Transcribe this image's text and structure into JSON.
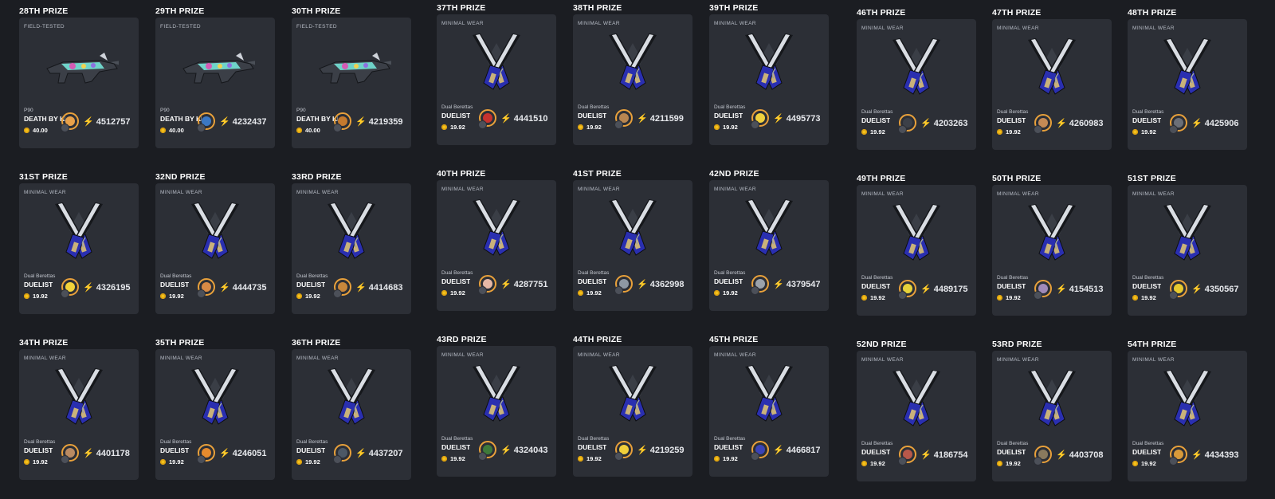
{
  "prizes": [
    {
      "title": "28TH PRIZE",
      "wear": "FIELD-TESTED",
      "weapon": "P90",
      "skin": "DEATH BY KI",
      "price": "40.00",
      "ticket": "4512757",
      "avatar_color": "#e8a14a",
      "kind": "p90"
    },
    {
      "title": "29TH PRIZE",
      "wear": "FIELD-TESTED",
      "weapon": "P90",
      "skin": "DEATH BY KI",
      "price": "40.00",
      "ticket": "4232437",
      "avatar_color": "#3b78c4",
      "kind": "p90"
    },
    {
      "title": "30TH PRIZE",
      "wear": "FIELD-TESTED",
      "weapon": "P90",
      "skin": "DEATH BY KI",
      "price": "40.00",
      "ticket": "4219359",
      "avatar_color": "#c57a2e",
      "kind": "p90"
    },
    {
      "title": "31ST PRIZE",
      "wear": "MINIMAL WEAR",
      "weapon": "Dual Berettas",
      "skin": "DUELIST",
      "price": "19.92",
      "ticket": "4326195",
      "avatar_color": "#f2d23a",
      "kind": "db"
    },
    {
      "title": "32ND PRIZE",
      "wear": "MINIMAL WEAR",
      "weapon": "Dual Berettas",
      "skin": "DUELIST",
      "price": "19.92",
      "ticket": "4444735",
      "avatar_color": "#d88a45",
      "kind": "db"
    },
    {
      "title": "33RD PRIZE",
      "wear": "MINIMAL WEAR",
      "weapon": "Dual Berettas",
      "skin": "DUELIST",
      "price": "19.92",
      "ticket": "4414683",
      "avatar_color": "#c8873b",
      "kind": "db"
    },
    {
      "title": "34TH PRIZE",
      "wear": "MINIMAL WEAR",
      "weapon": "Dual Berettas",
      "skin": "DUELIST",
      "price": "19.92",
      "ticket": "4401178",
      "avatar_color": "#b98a62",
      "kind": "db"
    },
    {
      "title": "35TH PRIZE",
      "wear": "MINIMAL WEAR",
      "weapon": "Dual Berettas",
      "skin": "DUELIST",
      "price": "19.92",
      "ticket": "4246051",
      "avatar_color": "#e58a2e",
      "kind": "db"
    },
    {
      "title": "36TH PRIZE",
      "wear": "MINIMAL WEAR",
      "weapon": "Dual Berettas",
      "skin": "DUELIST",
      "price": "19.92",
      "ticket": "4437207",
      "avatar_color": "#4c5866",
      "kind": "db"
    },
    {
      "title": "37TH PRIZE",
      "wear": "MINIMAL WEAR",
      "weapon": "Dual Berettas",
      "skin": "DUELIST",
      "price": "19.92",
      "ticket": "4441510",
      "avatar_color": "#c7332e",
      "kind": "db"
    },
    {
      "title": "38TH PRIZE",
      "wear": "MINIMAL WEAR",
      "weapon": "Dual Berettas",
      "skin": "DUELIST",
      "price": "19.92",
      "ticket": "4211599",
      "avatar_color": "#b88651",
      "kind": "db"
    },
    {
      "title": "39TH PRIZE",
      "wear": "MINIMAL WEAR",
      "weapon": "Dual Berettas",
      "skin": "DUELIST",
      "price": "19.92",
      "ticket": "4495773",
      "avatar_color": "#f0d03d",
      "kind": "db"
    },
    {
      "title": "40TH PRIZE",
      "wear": "MINIMAL WEAR",
      "weapon": "Dual Berettas",
      "skin": "DUELIST",
      "price": "19.92",
      "ticket": "4287751",
      "avatar_color": "#e6b8a6",
      "kind": "db"
    },
    {
      "title": "41ST PRIZE",
      "wear": "MINIMAL WEAR",
      "weapon": "Dual Berettas",
      "skin": "DUELIST",
      "price": "19.92",
      "ticket": "4362998",
      "avatar_color": "#8e98a3",
      "kind": "db"
    },
    {
      "title": "42ND PRIZE",
      "wear": "MINIMAL WEAR",
      "weapon": "Dual Berettas",
      "skin": "DUELIST",
      "price": "19.92",
      "ticket": "4379547",
      "avatar_color": "#9ba2aa",
      "kind": "db"
    },
    {
      "title": "43RD PRIZE",
      "wear": "MINIMAL WEAR",
      "weapon": "Dual Berettas",
      "skin": "DUELIST",
      "price": "19.92",
      "ticket": "4324043",
      "avatar_color": "#3f7a3a",
      "kind": "db"
    },
    {
      "title": "44TH PRIZE",
      "wear": "MINIMAL WEAR",
      "weapon": "Dual Berettas",
      "skin": "DUELIST",
      "price": "19.92",
      "ticket": "4219259",
      "avatar_color": "#f1cf3a",
      "kind": "db"
    },
    {
      "title": "45TH PRIZE",
      "wear": "MINIMAL WEAR",
      "weapon": "Dual Berettas",
      "skin": "DUELIST",
      "price": "19.92",
      "ticket": "4466817",
      "avatar_color": "#3a43b8",
      "kind": "db"
    },
    {
      "title": "46TH PRIZE",
      "wear": "MINIMAL WEAR",
      "weapon": "Dual Berettas",
      "skin": "DUELIST",
      "price": "19.92",
      "ticket": "4203263",
      "avatar_color": "#3c4048",
      "kind": "db"
    },
    {
      "title": "47TH PRIZE",
      "wear": "MINIMAL WEAR",
      "weapon": "Dual Berettas",
      "skin": "DUELIST",
      "price": "19.92",
      "ticket": "4260983",
      "avatar_color": "#c48a55",
      "kind": "db"
    },
    {
      "title": "48TH PRIZE",
      "wear": "MINIMAL WEAR",
      "weapon": "Dual Berettas",
      "skin": "DUELIST",
      "price": "19.92",
      "ticket": "4425906",
      "avatar_color": "#6b6f78",
      "kind": "db"
    },
    {
      "title": "49TH PRIZE",
      "wear": "MINIMAL WEAR",
      "weapon": "Dual Berettas",
      "skin": "DUELIST",
      "price": "19.92",
      "ticket": "4489175",
      "avatar_color": "#e7d23a",
      "kind": "db"
    },
    {
      "title": "50TH PRIZE",
      "wear": "MINIMAL WEAR",
      "weapon": "Dual Berettas",
      "skin": "DUELIST",
      "price": "19.92",
      "ticket": "4154513",
      "avatar_color": "#a08ab8",
      "kind": "db"
    },
    {
      "title": "51ST PRIZE",
      "wear": "MINIMAL WEAR",
      "weapon": "Dual Berettas",
      "skin": "DUELIST",
      "price": "19.92",
      "ticket": "4350567",
      "avatar_color": "#e7c92e",
      "kind": "db"
    },
    {
      "title": "52ND PRIZE",
      "wear": "MINIMAL WEAR",
      "weapon": "Dual Berettas",
      "skin": "DUELIST",
      "price": "19.92",
      "ticket": "4186754",
      "avatar_color": "#b8584a",
      "kind": "db"
    },
    {
      "title": "53RD PRIZE",
      "wear": "MINIMAL WEAR",
      "weapon": "Dual Berettas",
      "skin": "DUELIST",
      "price": "19.92",
      "ticket": "4403708",
      "avatar_color": "#8a7a5e",
      "kind": "db"
    },
    {
      "title": "54TH PRIZE",
      "wear": "MINIMAL WEAR",
      "weapon": "Dual Berettas",
      "skin": "DUELIST",
      "price": "19.92",
      "ticket": "4434393",
      "avatar_color": "#d89a3a",
      "kind": "db"
    }
  ],
  "icons": {
    "coin": "coin-icon",
    "ticket": "lightning-bolt-icon"
  },
  "colors": {
    "background": "#1b1d22",
    "card": "#2c2f36",
    "coin": "#f4c21b",
    "avatar_ring": "#e9a13b"
  }
}
